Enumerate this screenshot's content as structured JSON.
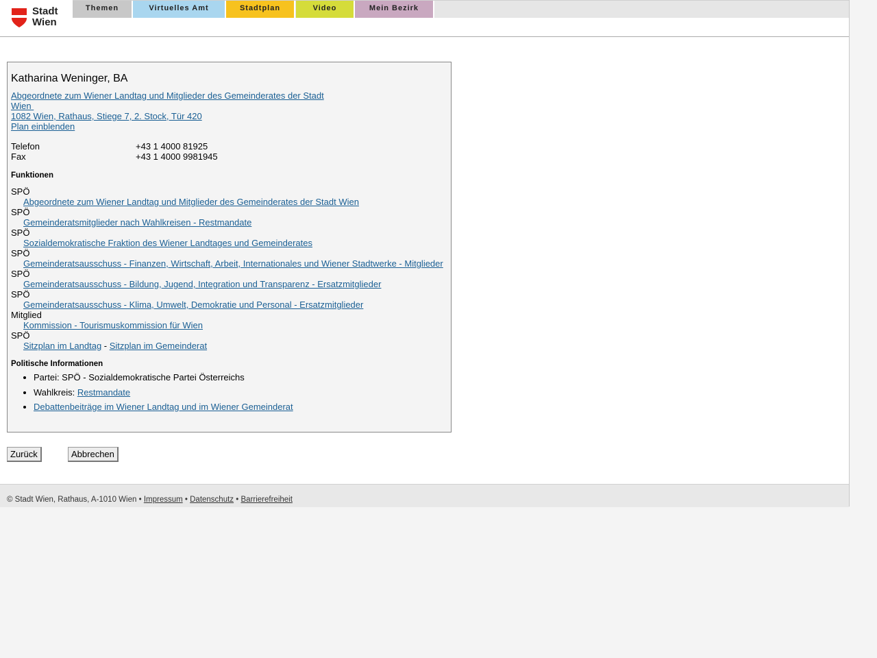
{
  "header": {
    "logo_text": "Stadt\nWien",
    "nav": [
      {
        "label": "Themen",
        "color": "#c8c8c8"
      },
      {
        "label": "Virtuelles Amt",
        "color": "#a9d6ef"
      },
      {
        "label": "Stadtplan",
        "color": "#f7c21e"
      },
      {
        "label": "Video",
        "color": "#d5dc3a"
      },
      {
        "label": "Mein Bezirk",
        "color": "#c9a8c0"
      }
    ]
  },
  "person": {
    "name": "Katharina Weninger, BA",
    "org_line1": "Abgeordnete zum Wiener Landtag und Mitglieder des Gemeinderates der Stadt",
    "org_line2": "Wien",
    "address": "1082 Wien, Rathaus, Stiege 7, 2. Stock, Tür 420",
    "plan_link": "Plan einblenden",
    "phone_label": "Telefon",
    "phone": "+43 1 4000 81925",
    "fax_label": "Fax",
    "fax": "+43 1 4000 9981945"
  },
  "functions": {
    "title": "Funktionen",
    "items": [
      {
        "role": "SPÖ",
        "link": "Abgeordnete zum Wiener Landtag und Mitglieder des Gemeinderates der Stadt Wien"
      },
      {
        "role": "SPÖ",
        "link": "Gemeinderatsmitglieder nach Wahlkreisen - Restmandate"
      },
      {
        "role": "SPÖ",
        "link": "Sozialdemokratische Fraktion des Wiener Landtages und Gemeinderates"
      },
      {
        "role": "SPÖ",
        "link": "Gemeinderatsausschuss - Finanzen, Wirtschaft, Arbeit, Internationales und Wiener Stadtwerke - Mitglieder"
      },
      {
        "role": "SPÖ",
        "link": "Gemeinderatsausschuss - Bildung, Jugend, Integration und Transparenz - Ersatzmitglieder"
      },
      {
        "role": "SPÖ",
        "link": "Gemeinderatsausschuss - Klima, Umwelt, Demokratie und Personal - Ersatzmitglieder"
      },
      {
        "role": "Mitglied",
        "link": "Kommission - Tourismuskommission für Wien"
      }
    ],
    "seat_role": "SPÖ",
    "seat_link1": "Sitzplan im Landtag",
    "seat_sep": " - ",
    "seat_link2": "Sitzplan im Gemeinderat"
  },
  "political": {
    "title": "Politische Informationen",
    "party": "Partei: SPÖ - Sozialdemokratische Partei Österreichs",
    "district_label": "Wahlkreis: ",
    "district_link": "Restmandate",
    "debates_link": "Debattenbeiträge im Wiener Landtag und im Wiener Gemeinderat"
  },
  "buttons": {
    "back": "Zurück",
    "cancel": "Abbrechen"
  },
  "footer": {
    "copyright": "© Stadt Wien, Rathaus, A-1010 Wien •",
    "impressum": "Impressum",
    "sep": "•",
    "datenschutz": "Datenschutz",
    "barrierefreiheit": "Barrierefreiheit"
  }
}
